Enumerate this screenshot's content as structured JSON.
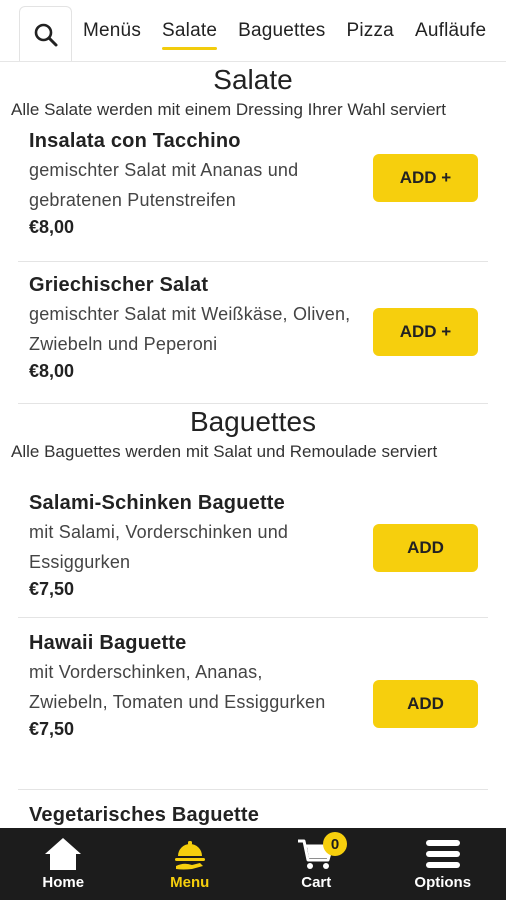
{
  "tabs": [
    {
      "label": "Menüs"
    },
    {
      "label": "Salate"
    },
    {
      "label": "Baguettes"
    },
    {
      "label": "Pizza"
    },
    {
      "label": "Aufläufe"
    }
  ],
  "active_tab": "Salate",
  "sections": [
    {
      "title": "Salate",
      "description": "Alle Salate werden mit einem Dressing Ihrer Wahl serviert",
      "items": [
        {
          "name": "Insalata con Tacchino",
          "description": "gemischter Salat mit Ananas und gebratenen Putenstreifen",
          "price": "€8,00",
          "button": "ADD +"
        },
        {
          "name": "Griechischer Salat",
          "description": "gemischter Salat mit Weißkäse, Oliven, Zwiebeln und Peperoni",
          "price": "€8,00",
          "button": "ADD +"
        }
      ]
    },
    {
      "title": "Baguettes",
      "description": "Alle Baguettes werden mit Salat und Remoulade serviert",
      "items": [
        {
          "name": "Salami-Schinken Baguette",
          "description": "mit Salami, Vorderschinken und Essiggurken",
          "price": "€7,50",
          "button": "ADD"
        },
        {
          "name": "Hawaii Baguette",
          "description": "mit Vorderschinken, Ananas, Zwiebeln, Tomaten und Essiggurken",
          "price": "€7,50",
          "button": "ADD"
        },
        {
          "name": "Vegetarisches Baguette"
        }
      ]
    }
  ],
  "bottom_nav": [
    {
      "label": "Home",
      "icon": "home-icon"
    },
    {
      "label": "Menu",
      "icon": "menu-cloche-icon"
    },
    {
      "label": "Cart",
      "icon": "cart-icon",
      "badge": "0"
    },
    {
      "label": "Options",
      "icon": "hamburger-icon"
    }
  ],
  "colors": {
    "accent": "#f6cf0d",
    "nav_bg": "#1c1c1c",
    "text": "#222222"
  }
}
